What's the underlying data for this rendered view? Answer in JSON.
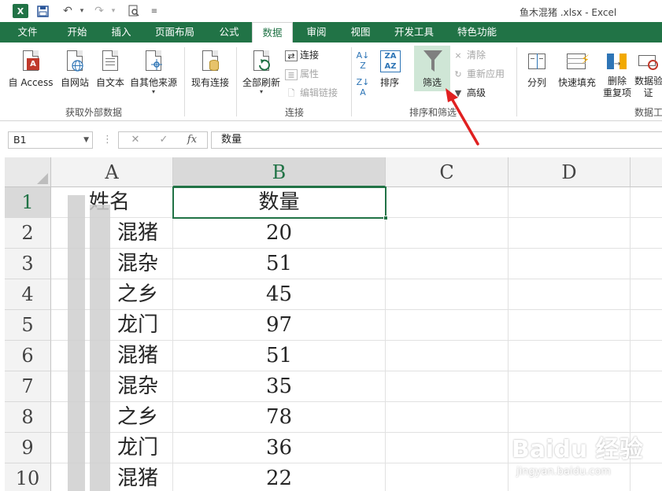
{
  "window": {
    "title": "鱼木混猪 .xlsx - Excel"
  },
  "tabs": [
    "文件",
    "开始",
    "插入",
    "页面布局",
    "公式",
    "数据",
    "审阅",
    "视图",
    "开发工具",
    "特色功能"
  ],
  "active_tab": "数据",
  "ribbon": {
    "get_external": {
      "label": "获取外部数据",
      "buttons": [
        "自 Access",
        "自网站",
        "自文本",
        "自其他来源"
      ]
    },
    "existing_connections": "现有连接",
    "connections": {
      "label": "连接",
      "refresh_all": "全部刷新",
      "connections": "连接",
      "properties": "属性",
      "edit_links": "编辑链接"
    },
    "sort_filter": {
      "label": "排序和筛选",
      "sort": "排序",
      "filter": "筛选",
      "clear": "清除",
      "reapply": "重新应用",
      "advanced": "高级"
    },
    "data_tools": {
      "label": "数据工",
      "text_to_columns": "分列",
      "flash_fill": "快速填充",
      "remove_dup_line1": "删除",
      "remove_dup_line2": "重复项",
      "validation_line1": "数据验",
      "validation_line2": "证"
    }
  },
  "formula_bar": {
    "name_box": "B1",
    "cancel": "✕",
    "enter": "✓",
    "fx": "fx",
    "content": "数量"
  },
  "sheet": {
    "columns": [
      "A",
      "B",
      "C",
      "D"
    ],
    "selected_cell": "B1",
    "rows": [
      {
        "num": "1",
        "a": "姓名",
        "b": "数量"
      },
      {
        "num": "2",
        "a": "混猪",
        "b": "20"
      },
      {
        "num": "3",
        "a": "混杂",
        "b": "51"
      },
      {
        "num": "4",
        "a": "之乡",
        "b": "45"
      },
      {
        "num": "5",
        "a": "龙门",
        "b": "97"
      },
      {
        "num": "6",
        "a": "混猪",
        "b": "51"
      },
      {
        "num": "7",
        "a": "混杂",
        "b": "35"
      },
      {
        "num": "8",
        "a": "之乡",
        "b": "78"
      },
      {
        "num": "9",
        "a": "龙门",
        "b": "36"
      },
      {
        "num": "10",
        "a": "混猪",
        "b": "22"
      }
    ]
  },
  "watermark": {
    "main": "Baidu 经验",
    "sub": "jingyan.baidu.com"
  },
  "colors": {
    "accent": "#217346",
    "annotation": "#e02020"
  }
}
